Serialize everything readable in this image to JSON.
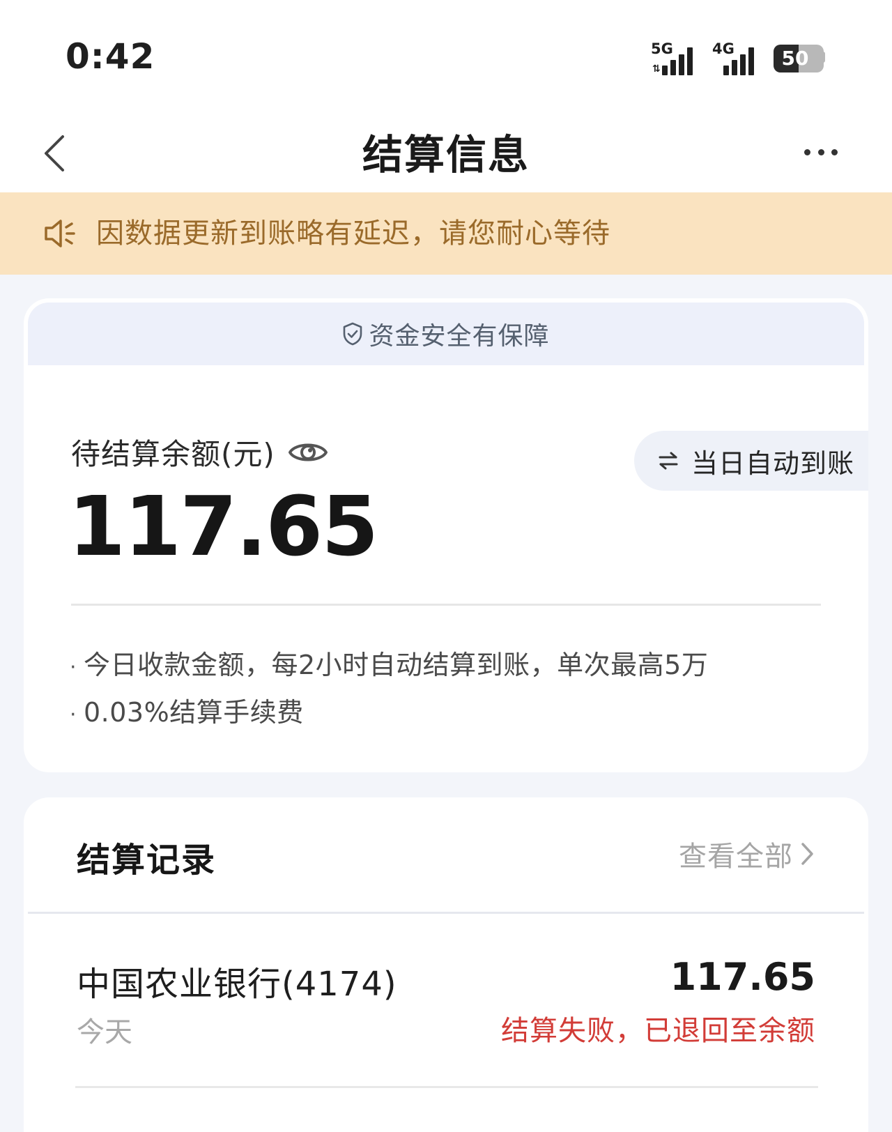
{
  "status_bar": {
    "time": "0:42",
    "signal_1": "5G",
    "signal_2": "4G",
    "battery": "50",
    "battery_level": 0.5
  },
  "header": {
    "title": "结算信息"
  },
  "notice": {
    "text": "因数据更新到账略有延迟，请您耐心等待"
  },
  "balance": {
    "safety_text": "资金安全有保障",
    "label": "待结算余额(元)",
    "amount": "117.65",
    "auto_settle_label": "当日自动到账",
    "notes": [
      "今日收款金额，每2小时自动结算到账，单次最高5万",
      "0.03%结算手续费"
    ]
  },
  "records": {
    "title": "结算记录",
    "view_all": "查看全部",
    "items": [
      {
        "bank": "中国农业银行(4174)",
        "date": "今天",
        "amount": "117.65",
        "status": "结算失败，已退回至余额"
      }
    ]
  },
  "colors": {
    "notice_bg": "#fae3c0",
    "notice_text": "#9a6a2a",
    "failure_red": "#d23c37",
    "page_bg": "#f3f5fa"
  }
}
